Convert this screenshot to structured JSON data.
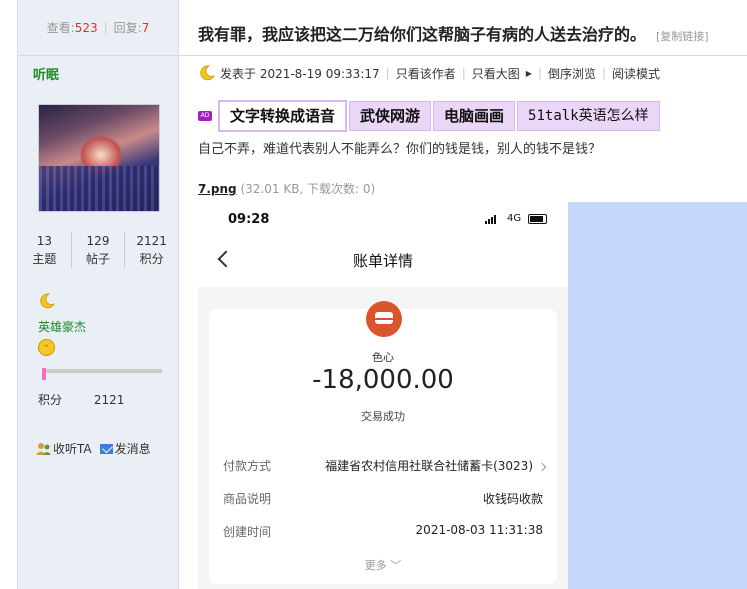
{
  "sidebar": {
    "view_label": "查看:",
    "view_count": "523",
    "reply_label": "回复:",
    "reply_count": "7",
    "username": "听眠",
    "stats": [
      {
        "value": "13",
        "label": "主题"
      },
      {
        "value": "129",
        "label": "帖子"
      },
      {
        "value": "2121",
        "label": "积分"
      }
    ],
    "rank": "英雄豪杰",
    "points_progress": 0.03,
    "points_label": "积分",
    "points_value": "2121",
    "follow_label": "收听TA",
    "message_label": "发消息"
  },
  "post": {
    "title": "我有罪，我应该把这二万给你们这帮脑子有病的人送去治疗的。",
    "copy_link": "[复制链接]",
    "posted_label": "发表于 2021-8-19 09:33:17",
    "meta_links": [
      "只看该作者",
      "只看大图",
      "倒序浏览",
      "阅读模式"
    ],
    "ad_badge": "AD",
    "ad_tags": [
      "文字转换成语音",
      "武侠网游",
      "电脑画画",
      "51talk英语怎么样"
    ],
    "body_text": "自己不弄，难道代表别人不能弄么？你们的钱是钱，别人的钱不是钱？",
    "attachment_name": "7.png",
    "attachment_info": "(32.01 KB, 下载次数: 0)"
  },
  "screenshot": {
    "time": "09:28",
    "network": "4G",
    "nav_title": "账单详情",
    "merchant": "色心",
    "amount": "-18,000.00",
    "status": "交易成功",
    "rows": [
      {
        "label": "付款方式",
        "value": "福建省农村信用社联合社储蓄卡(3023)"
      },
      {
        "label": "商品说明",
        "value": "收钱码收款"
      },
      {
        "label": "创建时间",
        "value": "2021-08-03 11:31:38"
      }
    ],
    "more": "更多"
  },
  "colors": {
    "accent_red": "#e0332c",
    "user_green": "#1d8b22",
    "ad_purple": "#ead6f7",
    "side_blue": "#c6d7fb"
  }
}
